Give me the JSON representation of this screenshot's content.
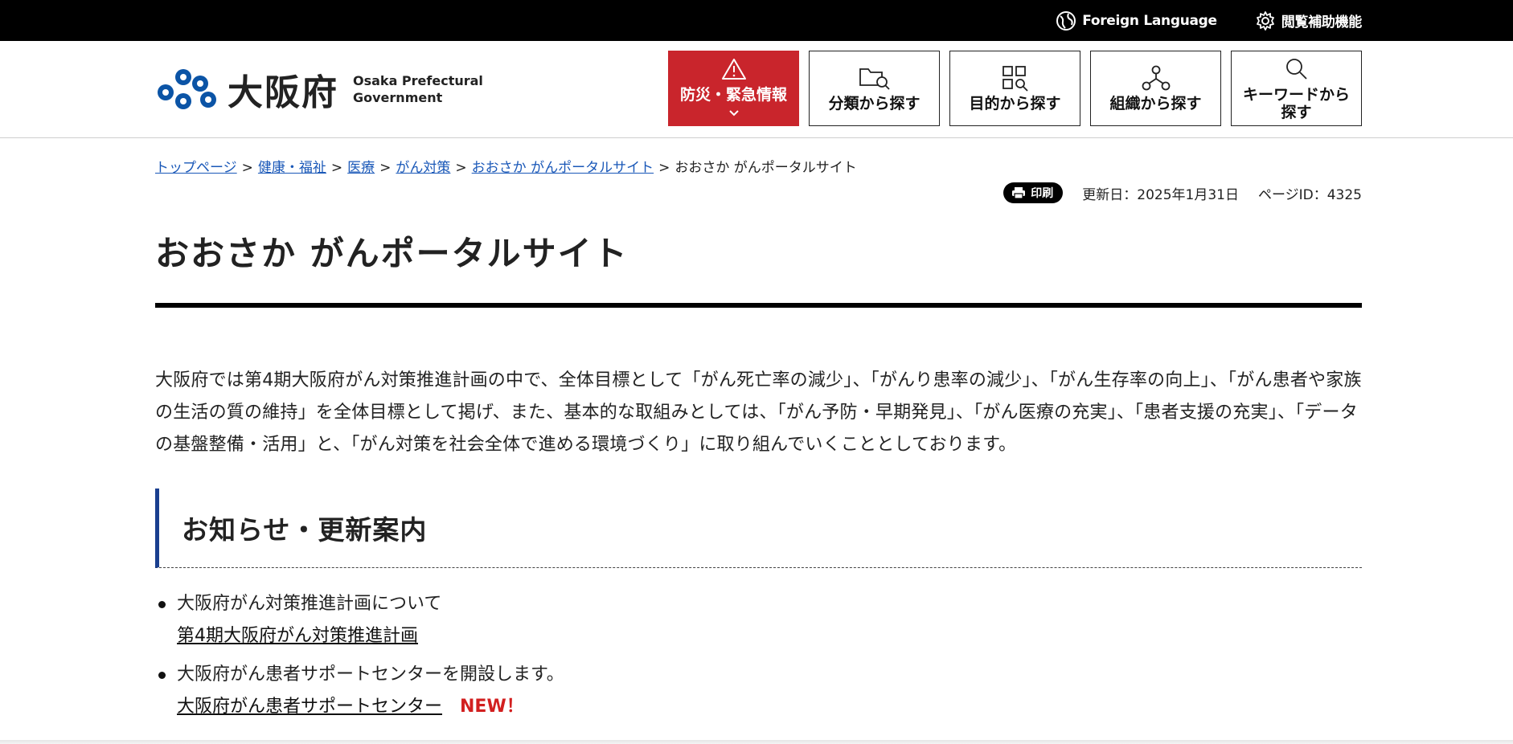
{
  "topbar": {
    "foreign_language": "Foreign Language",
    "accessibility": "閲覧補助機能"
  },
  "logo": {
    "kanji": "大阪府",
    "en_line1": "Osaka Prefectural",
    "en_line2": "Government"
  },
  "nav": {
    "emergency": "防災・緊急情報",
    "category": "分類から探す",
    "purpose": "目的から探す",
    "organization": "組織から探す",
    "keyword_line1": "キーワードから",
    "keyword_line2": "探す"
  },
  "breadcrumb": [
    "トップページ",
    "健康・福祉",
    "医療",
    "がん対策",
    "おおさか がんポータルサイト",
    "おおさか がんポータルサイト"
  ],
  "meta": {
    "print_label": "印刷",
    "updated": "更新日：2025年1月31日",
    "page_id": "ページID：4325"
  },
  "page_title": "おおさか がんポータルサイト",
  "intro": "大阪府では第4期大阪府がん対策推進計画の中で、全体目標として「がん死亡率の減少」、「がんり患率の減少」、「がん生存率の向上」、「がん患者や家族の生活の質の維持」を全体目標として掲げ、また、基本的な取組みとしては、「がん予防・早期発見」、「がん医療の充実」、「患者支援の充実」、「データの基盤整備・活用」と、「がん対策を社会全体で進める環境づくり」に取り組んでいくこととしております。",
  "section_title": "お知らせ・更新案内",
  "news": [
    {
      "text": "大阪府がん対策推進計画について",
      "link": "第4期大阪府がん対策推進計画",
      "badge": ""
    },
    {
      "text": "大阪府がん患者サポートセンターを開設します。",
      "link": "大阪府がん患者サポートセンター",
      "badge": "NEW！"
    }
  ],
  "colors": {
    "emergency_red": "#c9252c",
    "link_blue": "#1a58b8",
    "section_accent": "#1a3f8f",
    "new_badge": "#d21f1f"
  }
}
